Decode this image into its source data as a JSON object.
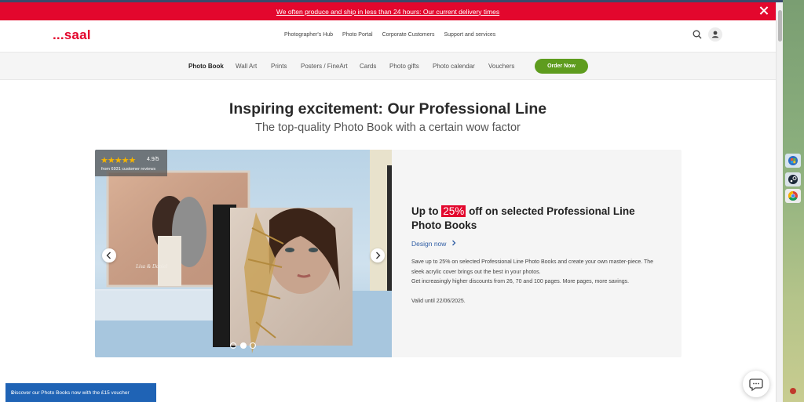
{
  "promo": {
    "text": "We often produce and ship in less than 24 hours: Our current delivery times"
  },
  "brand": {
    "logo": "...saal",
    "accent_color": "#e3072d"
  },
  "top_nav": [
    "Photographer's Hub",
    "Photo Portal",
    "Corporate Customers",
    "Support and services"
  ],
  "icons": {
    "search": "search-icon",
    "account": "user-icon"
  },
  "categories": {
    "items": [
      "Photo Book",
      "Wall Art",
      "Prints",
      "Posters / FineArt",
      "Cards",
      "Photo gifts",
      "Photo calendar",
      "Vouchers"
    ],
    "active": "Photo Book",
    "cta": "Order Now",
    "cta_color": "#5e9c1e"
  },
  "hero_heading": {
    "title": "Inspiring excitement: Our Professional Line",
    "subtitle": "The top-quality Photo Book with a certain wow factor"
  },
  "slide": {
    "rating": {
      "stars": "★★★★★",
      "score": "4.9/5",
      "reviews": "from 6931 customer reviews"
    },
    "title_before": "Up to",
    "badge": "25%",
    "title_after": "off on selected Professional Line Photo Books",
    "link": "Design now",
    "body_line1": "Save up to 25% on selected Professional Line Photo Books and create your own master-piece. The sleek acrylic cover brings out the best in your photos.",
    "body_line2": "Get increasingly higher discounts from 26, 70 and 100 pages. More pages, more savings.",
    "valid": "Valid until 22/06/2025.",
    "album_caption": "Lisa & Daniel",
    "slide_count": 3,
    "active_slide": 2
  },
  "voucher_bar": {
    "text": "Discover our Photo Books now with the £15 voucher",
    "close": "x"
  }
}
